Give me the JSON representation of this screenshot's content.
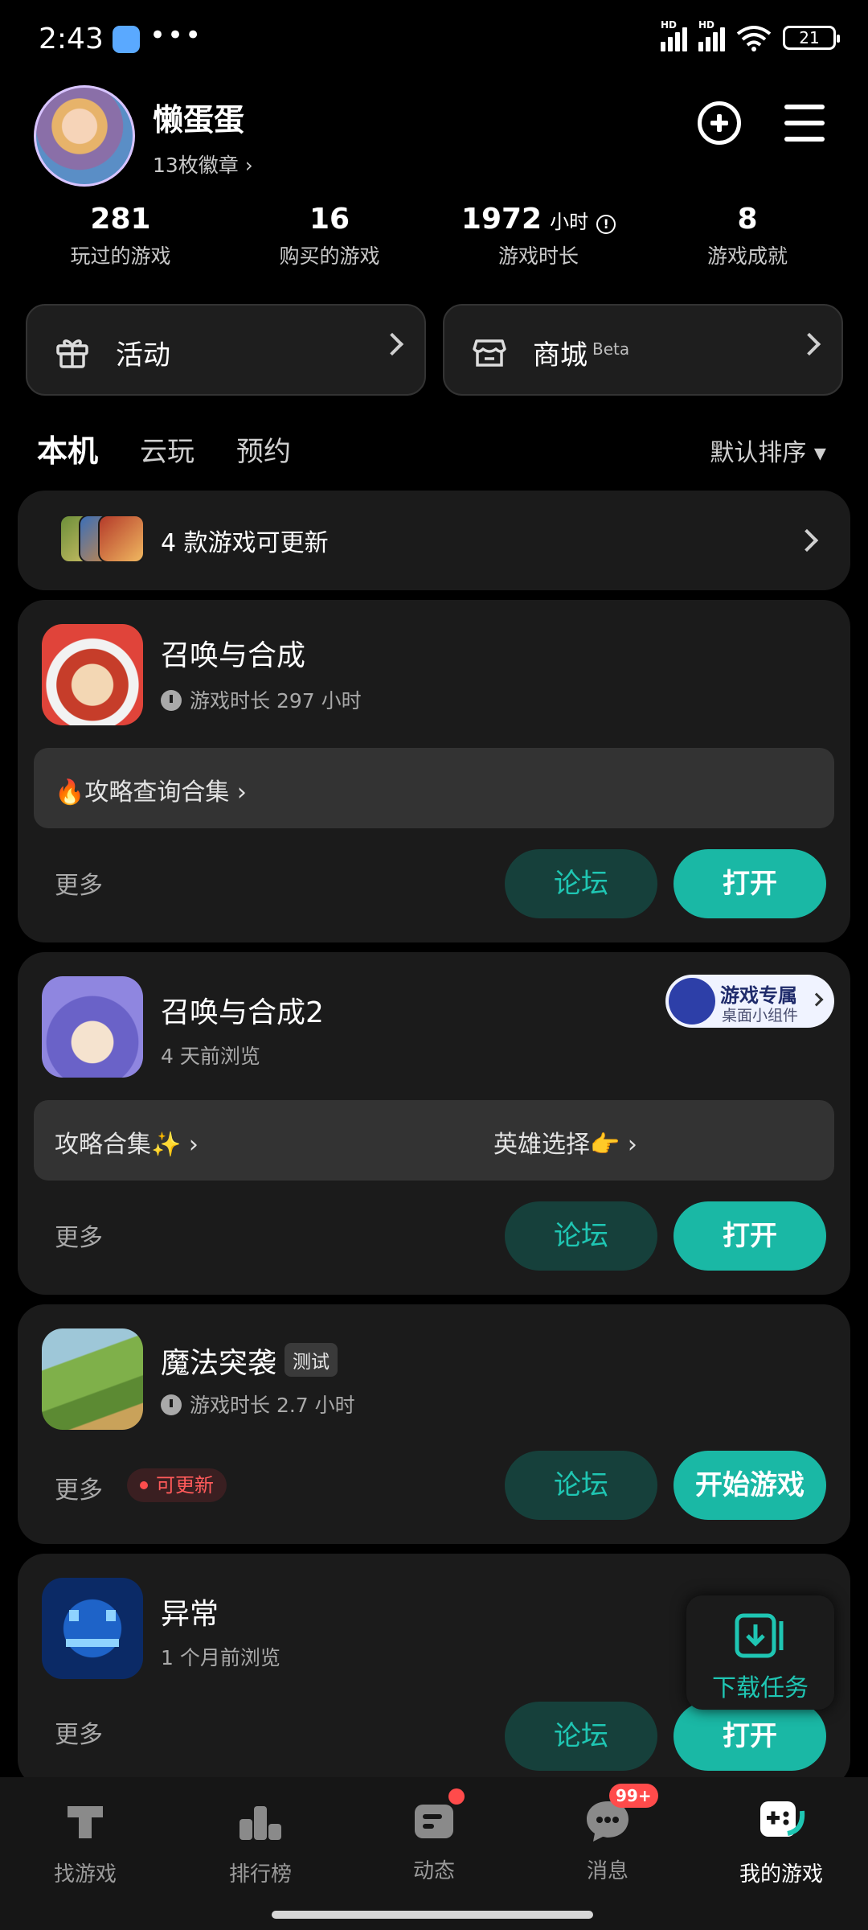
{
  "status_bar": {
    "time": "2:43",
    "battery": "21",
    "signal_labels": [
      "HD",
      "HD"
    ]
  },
  "profile": {
    "name": "懒蛋蛋",
    "badges": "13枚徽章 ›"
  },
  "stats": [
    {
      "value": "281",
      "unit": "",
      "label": "玩过的游戏"
    },
    {
      "value": "16",
      "unit": "",
      "label": "购买的游戏"
    },
    {
      "value": "1972",
      "unit": "小时",
      "label": "游戏时长"
    },
    {
      "value": "8",
      "unit": "",
      "label": "游戏成就"
    }
  ],
  "quick_links": {
    "activity": "活动",
    "shop": "商城",
    "shop_tag": "Beta"
  },
  "tabs": {
    "local": "本机",
    "cloud": "云玩",
    "reserve": "预约",
    "sort": "默认排序 ▾"
  },
  "update_banner": {
    "text": "4 款游戏可更新"
  },
  "games": [
    {
      "title": "召唤与合成",
      "sub": "游戏时长 297 小时",
      "guides": [
        "🔥攻略查询合集 ›"
      ],
      "more": "更多",
      "forum": "论坛",
      "action": "打开"
    },
    {
      "title": "召唤与合成2",
      "sub": "4 天前浏览",
      "guides": [
        "攻略合集✨ ›",
        "英雄选择👉 ›"
      ],
      "more": "更多",
      "forum": "论坛",
      "action": "打开",
      "widget": {
        "title": "游戏专属",
        "sub": "桌面小组件"
      }
    },
    {
      "title": "魔法突袭",
      "tag": "测试",
      "sub": "游戏时长 2.7 小时",
      "more": "更多",
      "update_tag": "可更新",
      "forum": "论坛",
      "action": "开始游戏"
    },
    {
      "title": "异常",
      "sub": "1 个月前浏览",
      "more": "更多",
      "forum": "论坛",
      "action": "打开"
    }
  ],
  "download_task": {
    "label": "下载任务"
  },
  "bottom_nav": [
    {
      "label": "找游戏"
    },
    {
      "label": "排行榜"
    },
    {
      "label": "动态"
    },
    {
      "label": "消息",
      "badge": "99+"
    },
    {
      "label": "我的游戏"
    }
  ],
  "colors": {
    "accent": "#1ab8a5",
    "forum_bg": "#16403b",
    "card_bg": "#1b1b1b",
    "badge": "#ff4b4b"
  }
}
